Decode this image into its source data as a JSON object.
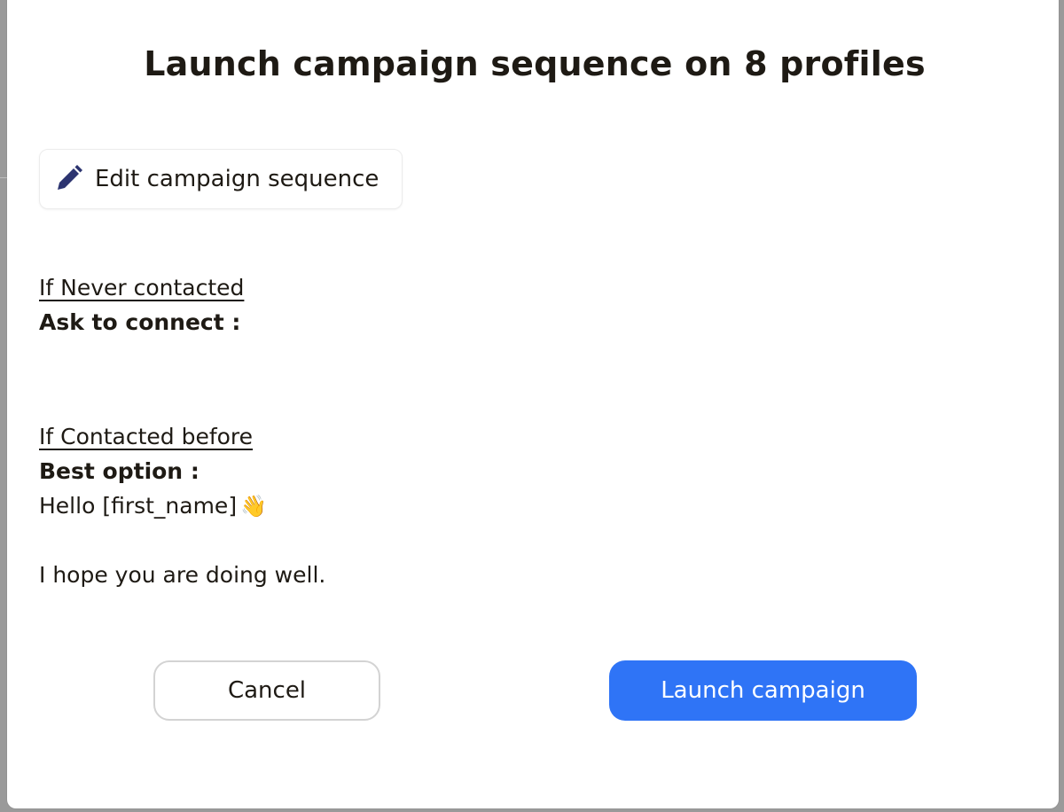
{
  "dialog": {
    "title": "Launch campaign sequence on 8 profiles",
    "edit_button_label": "Edit campaign sequence",
    "edit_icon": "pencil-icon",
    "sections": [
      {
        "heading": "If Never contacted",
        "subheading": "Ask to connect :"
      },
      {
        "heading": "If Contacted before",
        "subheading": "Best option :",
        "message_lines": [
          "Hello [first_name]",
          "I hope you are doing well."
        ],
        "greeting_emoji": "👋"
      }
    ],
    "cancel_label": "Cancel",
    "launch_label": "Launch campaign"
  },
  "colors": {
    "accent": "#2f74f6",
    "icon": "#2c3470",
    "text": "#1e1a14"
  }
}
